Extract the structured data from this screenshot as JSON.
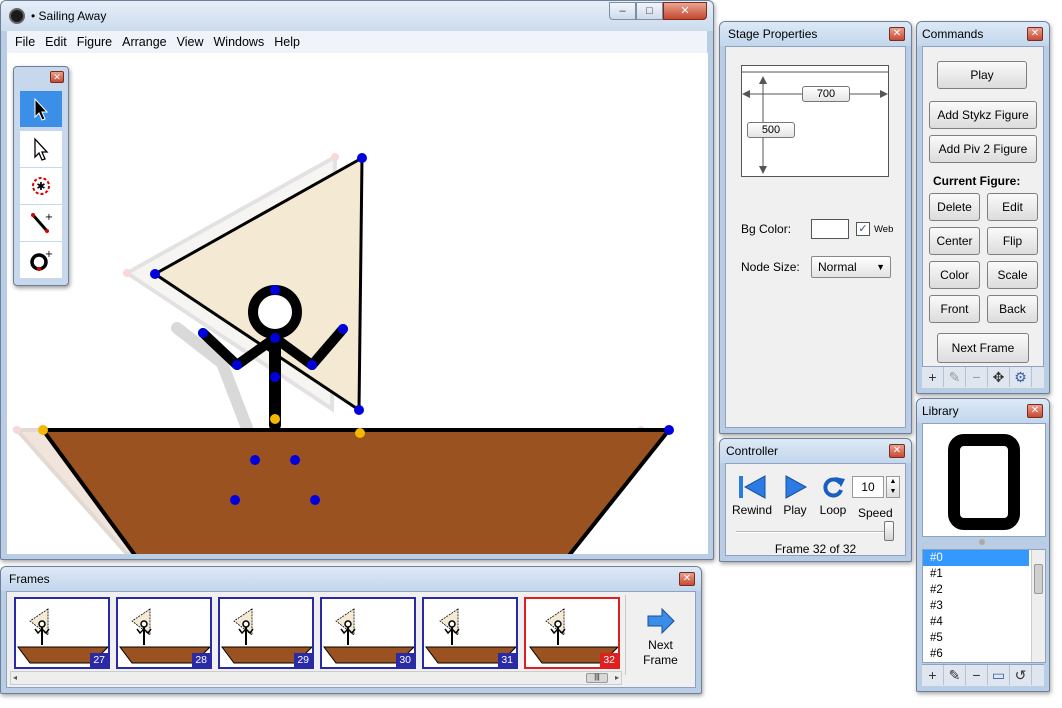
{
  "main_window": {
    "title": "• Sailing Away",
    "caption_buttons": {
      "minimize": "–",
      "maximize": "□",
      "close": "✕"
    },
    "menus": [
      "File",
      "Edit",
      "Figure",
      "Arrange",
      "View",
      "Windows",
      "Help"
    ]
  },
  "tools": {
    "close": "✕",
    "items": [
      {
        "name": "select-arrow-icon",
        "active": true
      },
      {
        "name": "node-select-arrow-icon",
        "active": false
      },
      {
        "name": "center-node-icon",
        "active": false
      },
      {
        "name": "add-line-icon",
        "active": false
      },
      {
        "name": "add-circle-icon",
        "active": false
      }
    ]
  },
  "stage_properties": {
    "title": "Stage Properties",
    "close": "✕",
    "width": "700",
    "height": "500",
    "bg_color_label": "Bg Color:",
    "bg_color": "#ffffff",
    "web_checkbox_mark": "✓",
    "web_label": "Web",
    "node_size_label": "Node Size:",
    "node_size_value": "Normal"
  },
  "commands": {
    "title": "Commands",
    "close": "✕",
    "play": "Play",
    "add_stykz": "Add Stykz Figure",
    "add_piv2": "Add Piv 2 Figure",
    "current_figure_label": "Current Figure:",
    "delete": "Delete",
    "edit": "Edit",
    "center": "Center",
    "flip": "Flip",
    "color": "Color",
    "scale": "Scale",
    "front": "Front",
    "back": "Back",
    "next_frame": "Next Frame",
    "toolstrip": [
      "+",
      "✎",
      "−",
      "✥",
      "⚙"
    ]
  },
  "controller": {
    "title": "Controller",
    "close": "✕",
    "rewind": "Rewind",
    "play": "Play",
    "loop": "Loop",
    "speed_value": "10",
    "speed_label": "Speed",
    "speed_level": 1.0,
    "frame_status": "Frame 32 of 32"
  },
  "library": {
    "title": "Library",
    "close": "✕",
    "items": [
      "#0",
      "#1",
      "#2",
      "#3",
      "#4",
      "#5",
      "#6"
    ],
    "selected_index": 0,
    "toolstrip": [
      "+",
      "✎",
      "−",
      "▭",
      "↺"
    ]
  },
  "frames": {
    "title": "Frames",
    "close": "✕",
    "items": [
      {
        "number": "27",
        "current": false
      },
      {
        "number": "28",
        "current": false
      },
      {
        "number": "29",
        "current": false
      },
      {
        "number": "30",
        "current": false
      },
      {
        "number": "31",
        "current": false
      },
      {
        "number": "32",
        "current": true
      }
    ],
    "next_frame_line1": "Next",
    "next_frame_line2": "Frame"
  },
  "colors": {
    "hull": "#9b5221",
    "sail": "#f4ead4",
    "node": "#0000dd",
    "center_node": "#f5b800",
    "frame_border": "#2a2aa6",
    "current_frame_border": "#e02020"
  }
}
